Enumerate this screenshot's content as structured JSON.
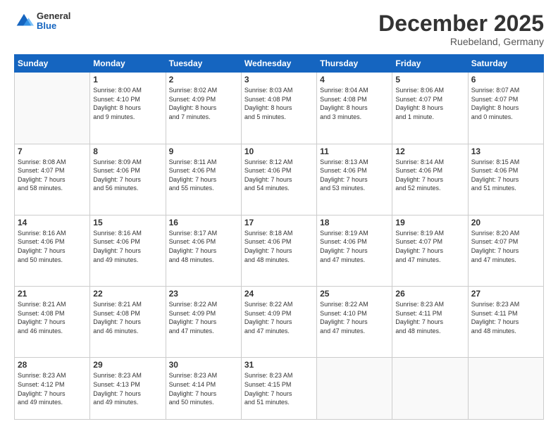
{
  "header": {
    "logo": {
      "general": "General",
      "blue": "Blue"
    },
    "title": "December 2025",
    "location": "Ruebeland, Germany"
  },
  "days_of_week": [
    "Sunday",
    "Monday",
    "Tuesday",
    "Wednesday",
    "Thursday",
    "Friday",
    "Saturday"
  ],
  "weeks": [
    [
      {
        "day": "",
        "info": ""
      },
      {
        "day": "1",
        "info": "Sunrise: 8:00 AM\nSunset: 4:10 PM\nDaylight: 8 hours\nand 9 minutes."
      },
      {
        "day": "2",
        "info": "Sunrise: 8:02 AM\nSunset: 4:09 PM\nDaylight: 8 hours\nand 7 minutes."
      },
      {
        "day": "3",
        "info": "Sunrise: 8:03 AM\nSunset: 4:08 PM\nDaylight: 8 hours\nand 5 minutes."
      },
      {
        "day": "4",
        "info": "Sunrise: 8:04 AM\nSunset: 4:08 PM\nDaylight: 8 hours\nand 3 minutes."
      },
      {
        "day": "5",
        "info": "Sunrise: 8:06 AM\nSunset: 4:07 PM\nDaylight: 8 hours\nand 1 minute."
      },
      {
        "day": "6",
        "info": "Sunrise: 8:07 AM\nSunset: 4:07 PM\nDaylight: 8 hours\nand 0 minutes."
      }
    ],
    [
      {
        "day": "7",
        "info": "Sunrise: 8:08 AM\nSunset: 4:07 PM\nDaylight: 7 hours\nand 58 minutes."
      },
      {
        "day": "8",
        "info": "Sunrise: 8:09 AM\nSunset: 4:06 PM\nDaylight: 7 hours\nand 56 minutes."
      },
      {
        "day": "9",
        "info": "Sunrise: 8:11 AM\nSunset: 4:06 PM\nDaylight: 7 hours\nand 55 minutes."
      },
      {
        "day": "10",
        "info": "Sunrise: 8:12 AM\nSunset: 4:06 PM\nDaylight: 7 hours\nand 54 minutes."
      },
      {
        "day": "11",
        "info": "Sunrise: 8:13 AM\nSunset: 4:06 PM\nDaylight: 7 hours\nand 53 minutes."
      },
      {
        "day": "12",
        "info": "Sunrise: 8:14 AM\nSunset: 4:06 PM\nDaylight: 7 hours\nand 52 minutes."
      },
      {
        "day": "13",
        "info": "Sunrise: 8:15 AM\nSunset: 4:06 PM\nDaylight: 7 hours\nand 51 minutes."
      }
    ],
    [
      {
        "day": "14",
        "info": "Sunrise: 8:16 AM\nSunset: 4:06 PM\nDaylight: 7 hours\nand 50 minutes."
      },
      {
        "day": "15",
        "info": "Sunrise: 8:16 AM\nSunset: 4:06 PM\nDaylight: 7 hours\nand 49 minutes."
      },
      {
        "day": "16",
        "info": "Sunrise: 8:17 AM\nSunset: 4:06 PM\nDaylight: 7 hours\nand 48 minutes."
      },
      {
        "day": "17",
        "info": "Sunrise: 8:18 AM\nSunset: 4:06 PM\nDaylight: 7 hours\nand 48 minutes."
      },
      {
        "day": "18",
        "info": "Sunrise: 8:19 AM\nSunset: 4:06 PM\nDaylight: 7 hours\nand 47 minutes."
      },
      {
        "day": "19",
        "info": "Sunrise: 8:19 AM\nSunset: 4:07 PM\nDaylight: 7 hours\nand 47 minutes."
      },
      {
        "day": "20",
        "info": "Sunrise: 8:20 AM\nSunset: 4:07 PM\nDaylight: 7 hours\nand 47 minutes."
      }
    ],
    [
      {
        "day": "21",
        "info": "Sunrise: 8:21 AM\nSunset: 4:08 PM\nDaylight: 7 hours\nand 46 minutes."
      },
      {
        "day": "22",
        "info": "Sunrise: 8:21 AM\nSunset: 4:08 PM\nDaylight: 7 hours\nand 46 minutes."
      },
      {
        "day": "23",
        "info": "Sunrise: 8:22 AM\nSunset: 4:09 PM\nDaylight: 7 hours\nand 47 minutes."
      },
      {
        "day": "24",
        "info": "Sunrise: 8:22 AM\nSunset: 4:09 PM\nDaylight: 7 hours\nand 47 minutes."
      },
      {
        "day": "25",
        "info": "Sunrise: 8:22 AM\nSunset: 4:10 PM\nDaylight: 7 hours\nand 47 minutes."
      },
      {
        "day": "26",
        "info": "Sunrise: 8:23 AM\nSunset: 4:11 PM\nDaylight: 7 hours\nand 48 minutes."
      },
      {
        "day": "27",
        "info": "Sunrise: 8:23 AM\nSunset: 4:11 PM\nDaylight: 7 hours\nand 48 minutes."
      }
    ],
    [
      {
        "day": "28",
        "info": "Sunrise: 8:23 AM\nSunset: 4:12 PM\nDaylight: 7 hours\nand 49 minutes."
      },
      {
        "day": "29",
        "info": "Sunrise: 8:23 AM\nSunset: 4:13 PM\nDaylight: 7 hours\nand 49 minutes."
      },
      {
        "day": "30",
        "info": "Sunrise: 8:23 AM\nSunset: 4:14 PM\nDaylight: 7 hours\nand 50 minutes."
      },
      {
        "day": "31",
        "info": "Sunrise: 8:23 AM\nSunset: 4:15 PM\nDaylight: 7 hours\nand 51 minutes."
      },
      {
        "day": "",
        "info": ""
      },
      {
        "day": "",
        "info": ""
      },
      {
        "day": "",
        "info": ""
      }
    ]
  ]
}
